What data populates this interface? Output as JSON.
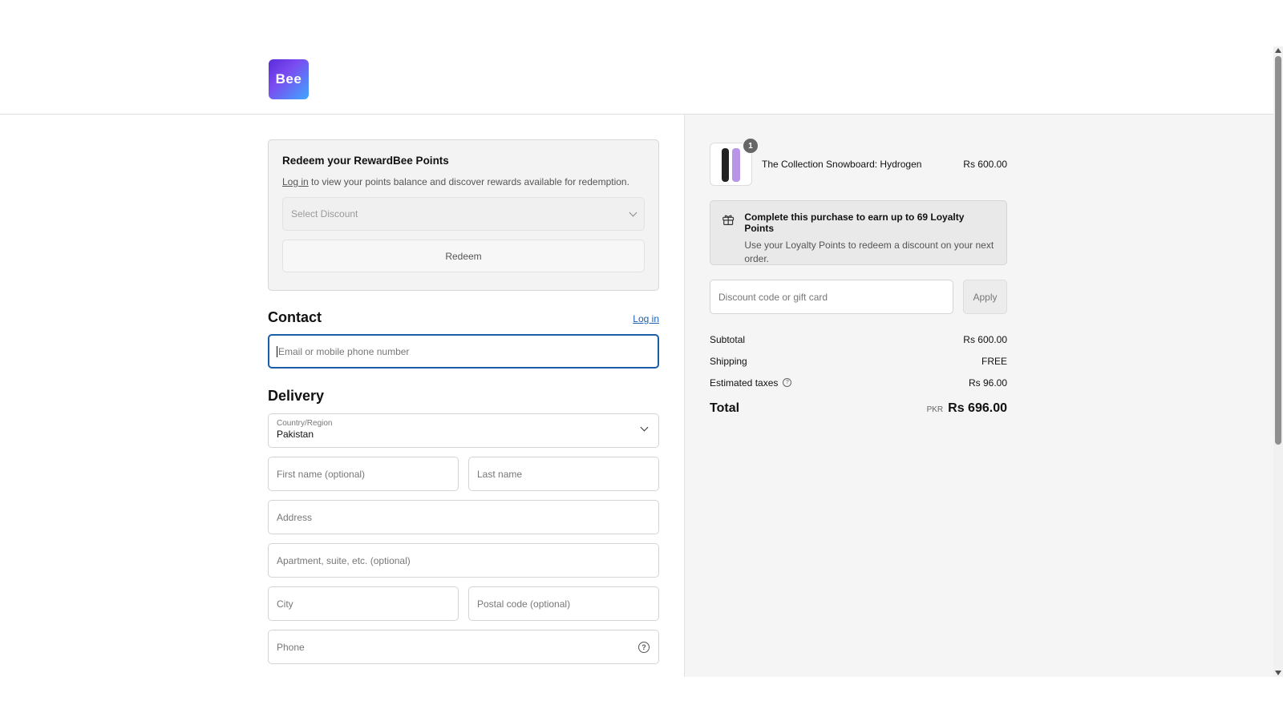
{
  "brand": {
    "logo_text": "Bee",
    "accent": "#5b2bd9"
  },
  "redeem": {
    "title": "Redeem your RewardBee Points",
    "login_link": "Log in",
    "text_suffix": "to view your points balance and discover rewards available for redemption.",
    "select_placeholder": "Select Discount",
    "button": "Redeem"
  },
  "contact": {
    "title": "Contact",
    "login_link": "Log in",
    "email_placeholder": "Email or mobile phone number"
  },
  "delivery": {
    "title": "Delivery",
    "country_label": "Country/Region",
    "country_value": "Pakistan",
    "first_name": "First name (optional)",
    "last_name": "Last name",
    "address": "Address",
    "apartment": "Apartment, suite, etc. (optional)",
    "city": "City",
    "postal": "Postal code (optional)",
    "phone": "Phone"
  },
  "summary": {
    "product": {
      "name": "The Collection Snowboard: Hydrogen",
      "price": "Rs 600.00",
      "quantity": "1"
    },
    "loyalty": {
      "title": "Complete this purchase to earn up to 69 Loyalty Points",
      "subtitle": "Use your Loyalty Points to redeem a discount on your next order."
    },
    "discount_placeholder": "Discount code or gift card",
    "apply": "Apply",
    "subtotal_label": "Subtotal",
    "subtotal_value": "Rs 600.00",
    "shipping_label": "Shipping",
    "shipping_value": "FREE",
    "taxes_label": "Estimated taxes",
    "taxes_value": "Rs 96.00",
    "total_label": "Total",
    "currency": "PKR",
    "total_value": "Rs 696.00"
  }
}
